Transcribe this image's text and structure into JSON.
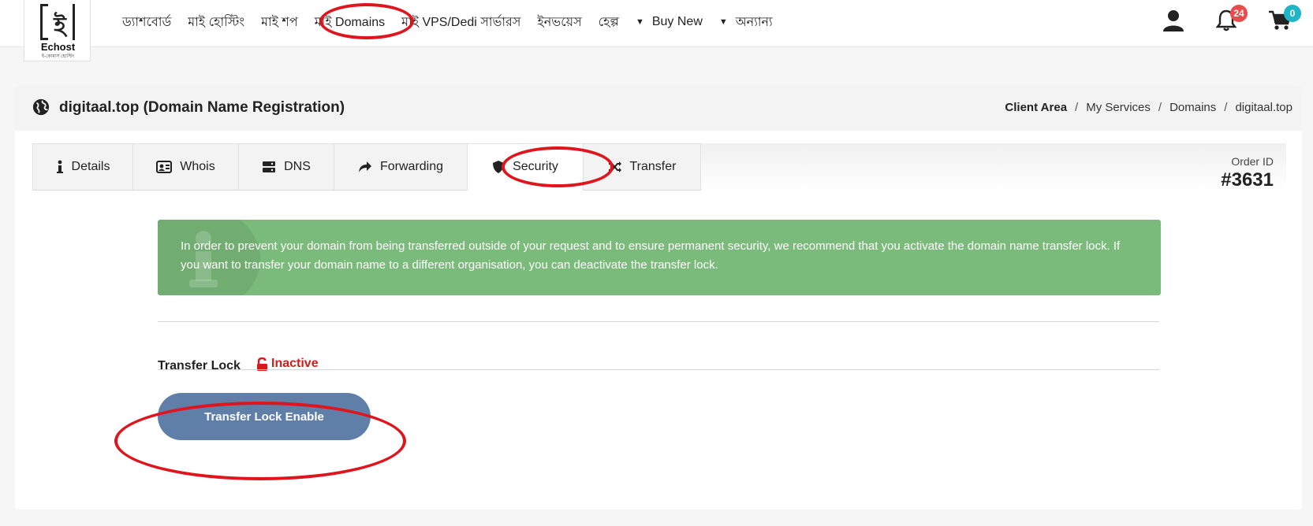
{
  "logo": {
    "glyph": "ই",
    "name": "Echost",
    "tagline": "ই-কোমার্স হোস্টিং"
  },
  "nav": {
    "items": [
      {
        "label": "ড্যাশবোর্ড"
      },
      {
        "label": "মাই হোস্টিং"
      },
      {
        "label": "মাই শপ"
      },
      {
        "label": "মাই Domains"
      },
      {
        "label": "মাই VPS/Dedi সার্ভারস"
      },
      {
        "label": "ইনভয়েস"
      },
      {
        "label": "হেল্প"
      },
      {
        "label": "Buy New"
      },
      {
        "label": "অন্যান্য"
      }
    ]
  },
  "header_icons": {
    "user": "user-icon",
    "notifications": {
      "icon": "bell-icon",
      "count": "24"
    },
    "cart": {
      "icon": "cart-icon",
      "count": "0"
    }
  },
  "colors": {
    "accent_red": "#e0141c",
    "alert_green": "#7aba7a",
    "button_blue": "#5f7fa8",
    "cart_badge": "#1fb5c9",
    "bell_badge": "#e84b4b",
    "inactive_red": "#d41b1b"
  },
  "page": {
    "title": "digitaal.top (Domain Name Registration)",
    "breadcrumb": [
      "Client Area",
      "My Services",
      "Domains",
      "digitaal.top"
    ]
  },
  "tabs": [
    {
      "label": "Details",
      "icon": "info-icon"
    },
    {
      "label": "Whois",
      "icon": "id-card-icon"
    },
    {
      "label": "DNS",
      "icon": "server-icon"
    },
    {
      "label": "Forwarding",
      "icon": "share-icon"
    },
    {
      "label": "Security",
      "icon": "shield-icon",
      "active": true
    },
    {
      "label": "Transfer",
      "icon": "shuffle-icon"
    }
  ],
  "order": {
    "label": "Order ID",
    "value": "#3631"
  },
  "alert": {
    "text": "In order to prevent your domain from being transferred outside of your request and to ensure permanent security, we recommend that you activate the domain name transfer lock. If you want to transfer your domain name to a different organisation, you can deactivate the transfer lock."
  },
  "transfer_lock": {
    "label": "Transfer Lock",
    "status": "Inactive",
    "button": "Transfer Lock Enable"
  }
}
